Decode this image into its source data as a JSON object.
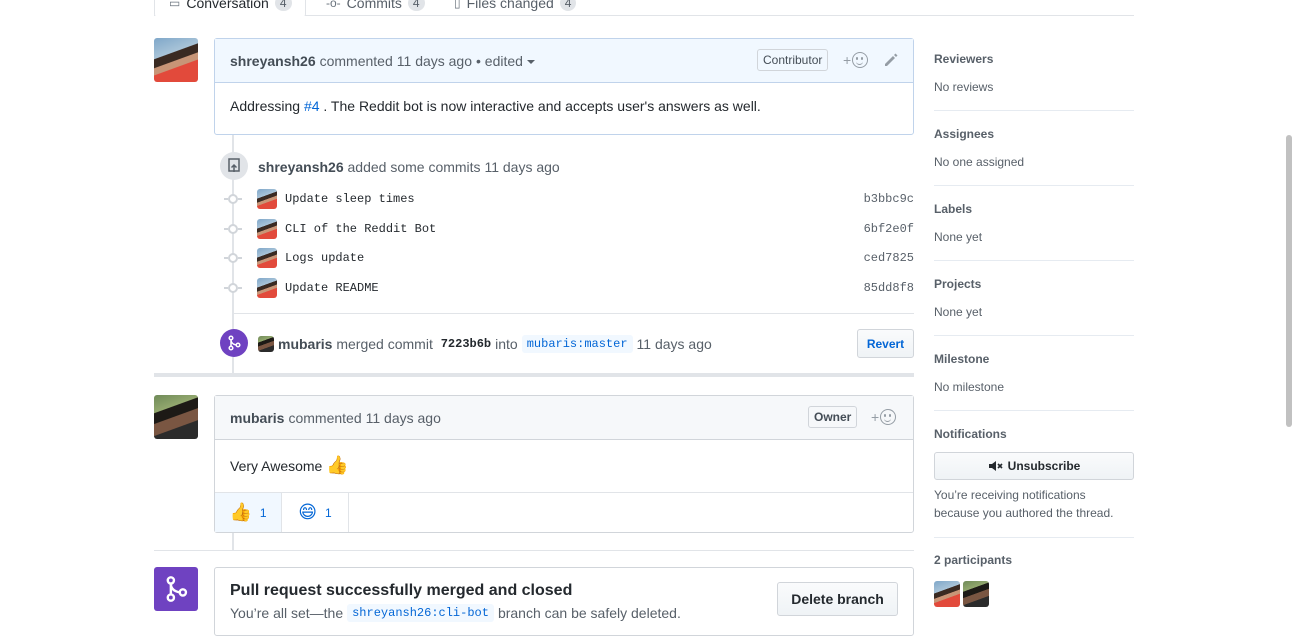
{
  "tabs": [
    {
      "label": "Conversation",
      "count": "4",
      "active": true
    },
    {
      "label": "Commits",
      "count": "4"
    },
    {
      "label": "Files changed",
      "count": "4"
    }
  ],
  "first_comment": {
    "author": "shreyansh26",
    "action": "commented",
    "time": "11 days ago",
    "edited": "• edited",
    "role": "Contributor",
    "reaction_add": "+",
    "body_prefix": "Addressing ",
    "issue_link": "#4",
    "body_suffix": " . The Reddit bot is now interactive and accepts user's answers as well."
  },
  "commits_event": {
    "author": "shreyansh26",
    "text": "added some commits",
    "time": "11 days ago",
    "commits": [
      {
        "message": "Update sleep times",
        "sha": "b3bbc9c"
      },
      {
        "message": "CLI of the Reddit Bot",
        "sha": "6bf2e0f"
      },
      {
        "message": "Logs update",
        "sha": "ced7825"
      },
      {
        "message": "Update README",
        "sha": "85dd8f8"
      }
    ]
  },
  "merge_event": {
    "author": "mubaris",
    "text": "merged commit",
    "sha": "7223b6b",
    "into": "into",
    "branch": "mubaris:master",
    "time": "11 days ago",
    "revert_label": "Revert"
  },
  "second_comment": {
    "author": "mubaris",
    "action": "commented",
    "time": "11 days ago",
    "role": "Owner",
    "reaction_add": "+",
    "body": "Very Awesome",
    "body_emoji": "👍",
    "reactions": [
      {
        "emoji": "👍",
        "count": "1"
      },
      {
        "emoji": "😄",
        "count": "1"
      }
    ]
  },
  "merge_box": {
    "title": "Pull request successfully merged and closed",
    "sub_prefix": "You’re all set—the",
    "branch": "shreyansh26:cli-bot",
    "sub_suffix": "branch can be safely deleted.",
    "delete_label": "Delete branch"
  },
  "sidebar": {
    "reviewers": {
      "heading": "Reviewers",
      "value": "No reviews"
    },
    "assignees": {
      "heading": "Assignees",
      "value": "No one assigned"
    },
    "labels": {
      "heading": "Labels",
      "value": "None yet"
    },
    "projects": {
      "heading": "Projects",
      "value": "None yet"
    },
    "milestone": {
      "heading": "Milestone",
      "value": "No milestone"
    },
    "notifications": {
      "heading": "Notifications",
      "button": "Unsubscribe",
      "note": "You’re receiving notifications because you authored the thread."
    },
    "participants": {
      "heading": "2 participants"
    }
  },
  "colors": {
    "link": "#0366d6",
    "merged_purple": "#6f42c1",
    "border": "#d1d5da",
    "comment_blue": "#f1f8ff"
  }
}
